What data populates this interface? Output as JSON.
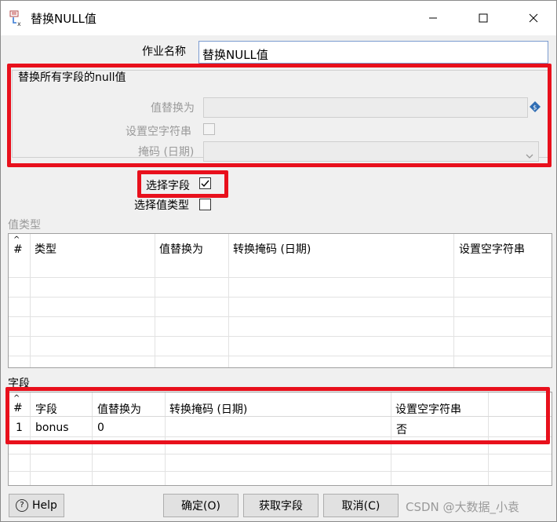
{
  "window": {
    "title": "替换NULL值"
  },
  "form": {
    "job_name_label": "作业名称",
    "job_name_value": "替换NULL值",
    "group_title": "替换所有字段的null值",
    "replace_with_label": "值替换为",
    "set_empty_label": "设置空字符串",
    "mask_label": "掩码 (日期)",
    "select_fields_label": "选择字段",
    "select_fields_checked": true,
    "select_value_type_label": "选择值类型",
    "select_value_type_checked": false
  },
  "value_types": {
    "section_label": "值类型",
    "columns": [
      "#",
      "类型",
      "值替换为",
      "转换掩码 (日期)",
      "设置空字符串"
    ]
  },
  "fields": {
    "section_label": "字段",
    "columns": [
      "#",
      "字段",
      "值替换为",
      "转换掩码 (日期)",
      "设置空字符串"
    ],
    "rows": [
      {
        "num": "1",
        "field": "bonus",
        "replace": "0",
        "mask": "",
        "set_empty": "否"
      }
    ]
  },
  "buttons": {
    "help": "Help",
    "ok": "确定(O)",
    "get_fields": "获取字段",
    "cancel": "取消(C)"
  },
  "watermark": "CSDN @大数据_小袁",
  "colors": {
    "highlight": "#e8101c",
    "accent": "#7a9bd0"
  }
}
